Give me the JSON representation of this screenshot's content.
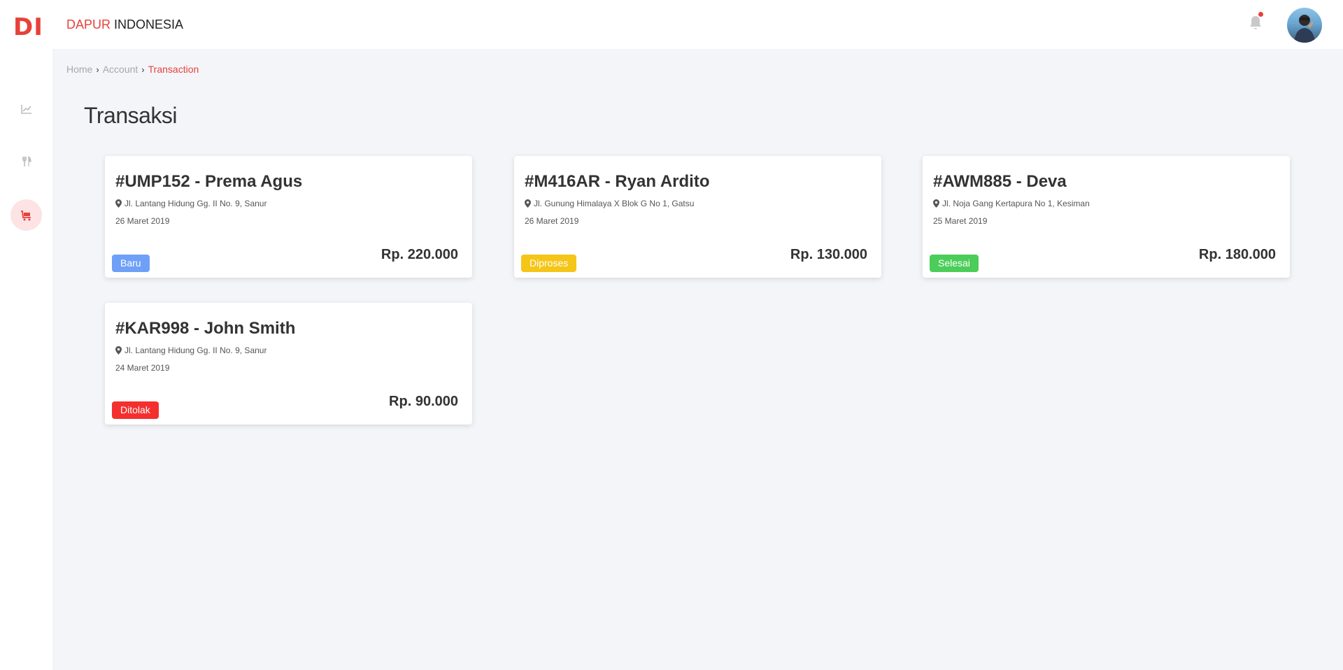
{
  "sidebar": {
    "logo": "DI",
    "items": [
      {
        "icon": "chart-line-icon",
        "active": false
      },
      {
        "icon": "utensils-icon",
        "active": false
      },
      {
        "icon": "cart-icon",
        "active": true
      }
    ]
  },
  "header": {
    "brand_accent": "DAPUR",
    "brand_rest": " INDONESIA",
    "notification_icon": "bell-icon",
    "avatar": "user-avatar"
  },
  "breadcrumb": {
    "items": [
      "Home",
      "Account"
    ],
    "current": "Transaction"
  },
  "page": {
    "title": "Transaksi"
  },
  "transactions": [
    {
      "title": "#UMP152 - Prema Agus",
      "address": "Jl. Lantang Hidung Gg. II No. 9, Sanur",
      "date": "26 Maret 2019",
      "status": "Baru",
      "status_color": "#6ea0f7",
      "price": "Rp. 220.000"
    },
    {
      "title": "#M416AR - Ryan Ardito",
      "address": "Jl. Gunung Himalaya X Blok G No 1, Gatsu",
      "date": "26 Maret 2019",
      "status": "Diproses",
      "status_color": "#f5c518",
      "price": "Rp. 130.000"
    },
    {
      "title": "#AWM885 - Deva",
      "address": "Jl. Noja Gang Kertapura No 1, Kesiman",
      "date": "25 Maret 2019",
      "status": "Selesai",
      "status_color": "#4ccd59",
      "price": "Rp. 180.000"
    },
    {
      "title": "#KAR998 - John Smith",
      "address": "Jl. Lantang Hidung Gg. II No. 9, Sanur",
      "date": "24 Maret 2019",
      "status": "Ditolak",
      "status_color": "#f3302e",
      "price": "Rp. 90.000"
    }
  ],
  "colors": {
    "accent": "#e8403a",
    "background": "#f3f5f9"
  }
}
